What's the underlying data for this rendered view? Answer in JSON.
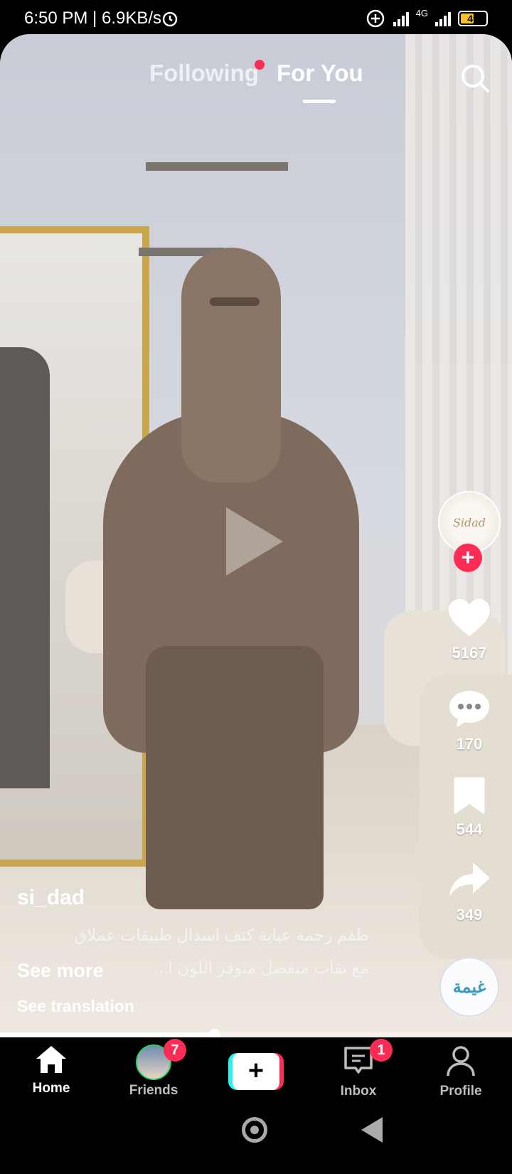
{
  "status_bar": {
    "time_speed": "6:50 PM | 6.9KB/s",
    "network": "4G",
    "battery": "49"
  },
  "top_tabs": {
    "following": "Following",
    "for_you": "For You"
  },
  "rail": {
    "avatar_text": "Sidad",
    "likes": "5167",
    "comments": "170",
    "saves": "544",
    "shares": "349",
    "music_text": "غيمة"
  },
  "caption": {
    "username": "si_dad",
    "line1": "طقم رحمة عباية كتف اسدال طيبقات عملاق",
    "line2": "مع تقاب منفصل متوفر اللون ا...",
    "see_more": "See more",
    "see_translation": "See translation"
  },
  "progress": {
    "fraction": 0.42
  },
  "nav": {
    "home": "Home",
    "friends": "Friends",
    "friends_badge": "7",
    "inbox": "Inbox",
    "inbox_badge": "1",
    "profile": "Profile",
    "create": "+"
  },
  "colors": {
    "accent": "#fe2c55",
    "cyan": "#25f4ee"
  }
}
